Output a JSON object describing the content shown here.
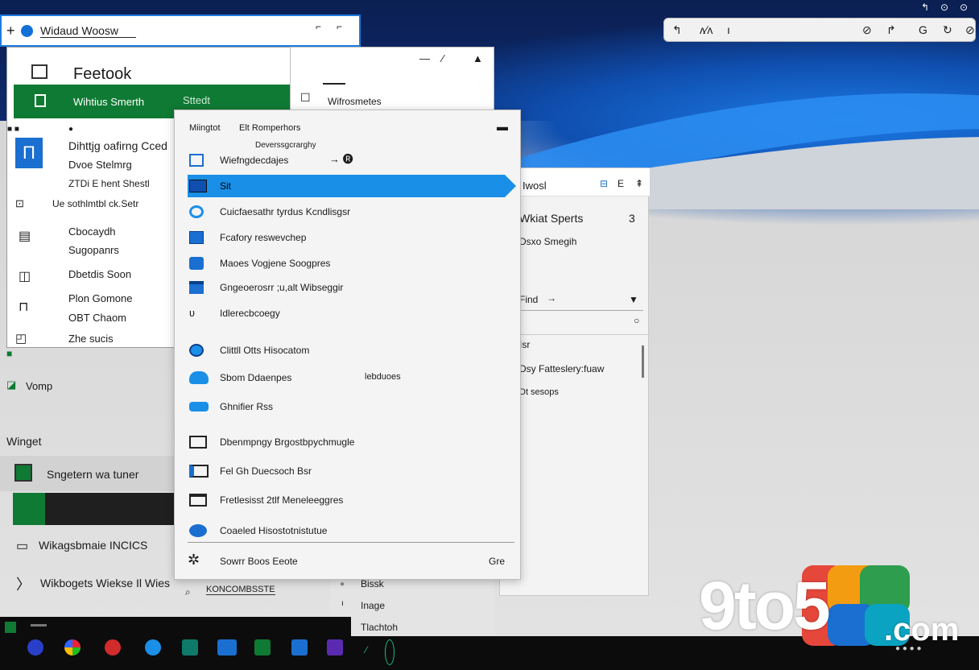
{
  "topbar": {
    "address_title": "Widaud Woosw",
    "search_glyphs": [
      "↰",
      "ᴧ∕ᴧ",
      "ı",
      "⊘",
      "↱",
      "G",
      "↻"
    ],
    "sys_icons": [
      "↰",
      "⊙",
      "⊙"
    ]
  },
  "left_panel": {
    "title": "Feetook",
    "green_bar_text": "Wihtius Smerth",
    "green_bar_text2": "Sttedt",
    "items": [
      "Dihttjg oafirng Cced",
      "Dvoe Stelmrg",
      "ZTDi E hent Shestl",
      "Ue sothlmtbl ck.Setr",
      "Cbocaydh",
      "Sugopanrs",
      "Dbetdis Soon",
      "Plon Gomone",
      "OBT Chaom",
      "Zhe sucis"
    ]
  },
  "mid_window": {
    "label": "Wifrosmetes"
  },
  "right_panel": {
    "header": "Iwosl",
    "header_icons": [
      "⊟",
      "E",
      "⇞"
    ],
    "title": "Wkiat Sperts",
    "count": "3",
    "subtitle": "Dsxo Smegih",
    "dropdown_label": "Find",
    "rows": [
      "Isr",
      "Dsy Fatteslery:fuaw",
      "Dt sesops"
    ]
  },
  "main_menu": {
    "header_left": "Miingtot",
    "header_mid": "Elt  Romperhors",
    "subheader": "Deverssgcrarghy",
    "arrow_text": "→ 🅡",
    "items": [
      {
        "label": "Wiefngdecdajes",
        "icon": "window-icon"
      },
      {
        "label": "Sit",
        "icon": "list-icon"
      },
      {
        "label": "Cuicfaesathr tyrdus Kcndlisgsr",
        "icon": "edge-icon"
      },
      {
        "label": "Fcafory reswevchep",
        "icon": "square-icon"
      },
      {
        "label": "Maoes Vogjene Soogpres",
        "icon": "store-icon"
      },
      {
        "label": "Gngeoerosrr ;u,alt Wibseggir",
        "icon": "mail-icon"
      },
      {
        "label": "Idlerecbcoegy",
        "icon": "hook-icon"
      },
      {
        "label": "Clittll Otts Hisocatom",
        "icon": "globe-icon"
      },
      {
        "label": "Sbom Ddaenpes",
        "icon": "cloud-icon",
        "extra": "lebduoes"
      },
      {
        "label": "Ghnifier Rss",
        "icon": "pill-icon"
      },
      {
        "label": "Dbenmpngy Brgostbpychmugle",
        "icon": "frame-icon"
      },
      {
        "label": "Fel Gh Duecsoch Bsr",
        "icon": "desktop-icon"
      },
      {
        "label": "Fretlesisst 2tlf Meneleeggres",
        "icon": "monitor-icon"
      },
      {
        "label": "Coaeled Hisostotnistutue",
        "icon": "onedrive-icon"
      }
    ],
    "footer_label": "Sowrr Boos Eeote",
    "footer_right": "Gre"
  },
  "bottom_stack": [
    "Bissk",
    "Inage",
    "Tlachtoh"
  ],
  "left_bottom": {
    "vomp": "Vomp",
    "winget": "Winget",
    "items": [
      "Sngetern wa tuner",
      "Wikagsbmaie INCICS",
      "Wikbogets Wiekse Il Wies",
      "KONCOMBSSTE"
    ]
  },
  "taskbar": {
    "labels": [
      "",
      "",
      "",
      "",
      "",
      "",
      "",
      "",
      "",
      ""
    ]
  },
  "watermark": {
    "text": "9to5",
    "suffix": ".com"
  },
  "colors": {
    "accent_blue": "#1a8fe8",
    "accent_green": "#0f7a33",
    "taskbar": "#0c0c0c"
  }
}
